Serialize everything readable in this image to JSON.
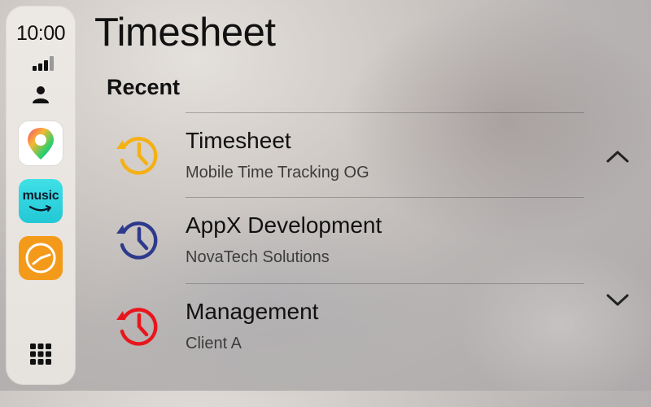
{
  "status": {
    "time": "10:00"
  },
  "dock": {
    "apps": [
      {
        "name": "maps-icon"
      },
      {
        "name": "amazon-music-icon",
        "label": "music"
      },
      {
        "name": "timesheet-clock-icon"
      }
    ]
  },
  "header": {
    "title": "Timesheet"
  },
  "section": {
    "title": "Recent"
  },
  "items": [
    {
      "title": "Timesheet",
      "subtitle": "Mobile Time Tracking OG",
      "icon_color": "#f5b014"
    },
    {
      "title": "AppX Development",
      "subtitle": "NovaTech Solutions",
      "icon_color": "#2e3a8c"
    },
    {
      "title": "Management",
      "subtitle": "Client A",
      "icon_color": "#e8161c"
    }
  ],
  "colors": {
    "timer_app": "#f49a1b",
    "music_app": "#23c8d6"
  }
}
